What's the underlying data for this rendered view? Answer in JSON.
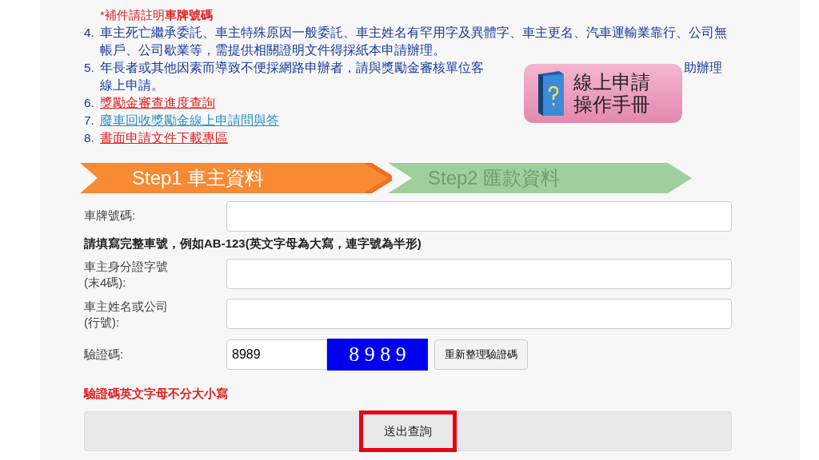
{
  "notes": {
    "note": "*補件請註明**車牌號碼**",
    "items": [
      {
        "number": "4.",
        "kind": "text",
        "text": "車主死亡繼承委託、車主特殊原因一般委託、車主姓名有罕用字及異體字、車主更名、汽車運輸業靠行、公司無帳戶、公司歇業等，需提供相關證明文件得採紙本申請辦理。"
      },
      {
        "number": "5.",
        "kind": "covered",
        "text": "年長者或其他因素而導致不便採網路申辦者，請與獎勵金審核單位客",
        "text_after": "助辦理",
        "text_line2": "線上申請。"
      },
      {
        "number": "6.",
        "kind": "link",
        "text": "獎勵金審查進度查詢",
        "color": "#e02020"
      },
      {
        "number": "7.",
        "kind": "link",
        "text": "廢車回收獎勵金線上申請問與答",
        "color": "#2a8fc8"
      },
      {
        "number": "8.",
        "kind": "link",
        "text": "書面申請文件下載專區",
        "color": "#e02020"
      }
    ]
  },
  "manual_badge": {
    "line1": "線上申請",
    "line2": "操作手冊"
  },
  "steps": [
    {
      "label": "Step1 車主資料",
      "selected": true
    },
    {
      "label": "Step2 匯款資料",
      "selected": false
    }
  ],
  "form": {
    "plate_label": "車牌號碼:",
    "plate_hint": "請填寫完整車號，例如**AB-123**(英文字母為大寫，連字號為半形)",
    "id_label": "車主身分證字號",
    "id_label2": "(末4碼):",
    "name_label": "車主姓名或公司",
    "name_label2": "(行號):",
    "captcha_label": "驗證碼:",
    "captcha_value": "8989",
    "captcha_image": "8 9 8 9",
    "refresh_button": "重新整理驗證碼",
    "captcha_note": "驗證碼英文字母不分大小寫",
    "submit_button": "送出查詢"
  }
}
